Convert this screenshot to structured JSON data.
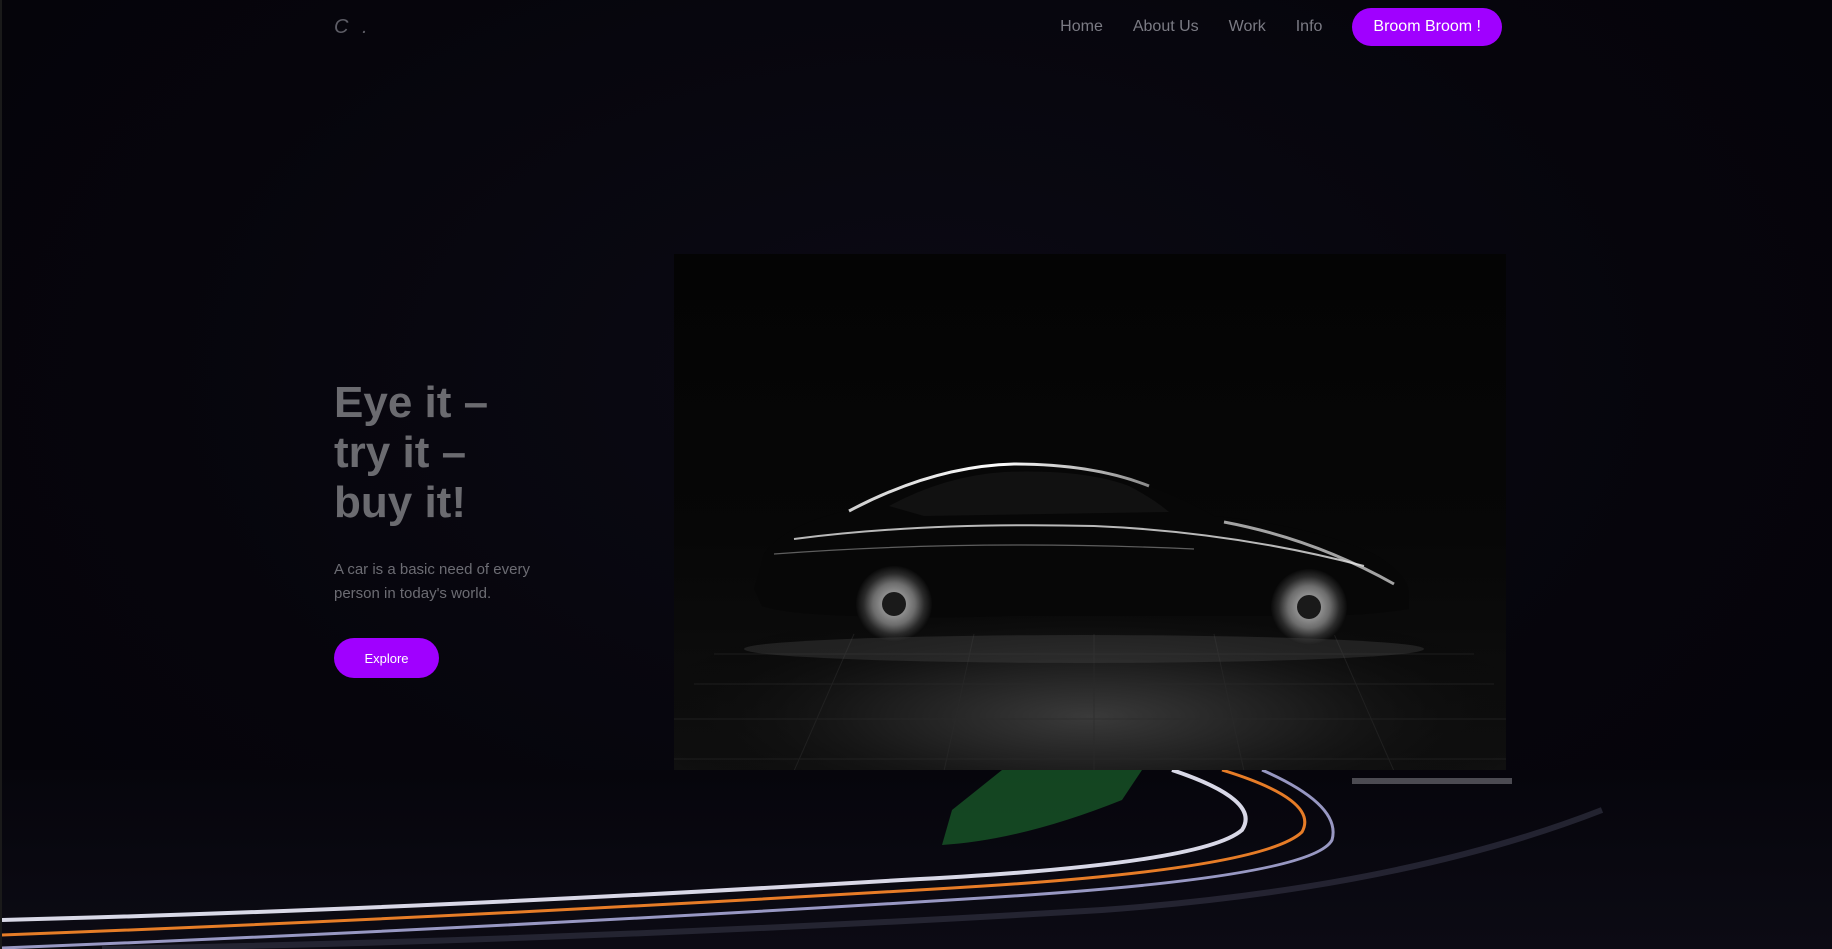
{
  "header": {
    "logo": "C .",
    "nav": [
      {
        "label": "Home"
      },
      {
        "label": "About Us"
      },
      {
        "label": "Work"
      },
      {
        "label": "Info"
      }
    ],
    "cta_label": "Broom Broom !"
  },
  "hero": {
    "title": "Eye it –\ntry it –\nbuy it!",
    "subtitle": "A car is a basic need of every person in today's world.",
    "button_label": "Explore"
  },
  "colors": {
    "accent": "#a000ff",
    "background": "#06050c",
    "text_muted": "#6b6b70"
  },
  "icons": {
    "hero_image": "car-photo",
    "bottom_image": "light-trails-road-photo"
  }
}
